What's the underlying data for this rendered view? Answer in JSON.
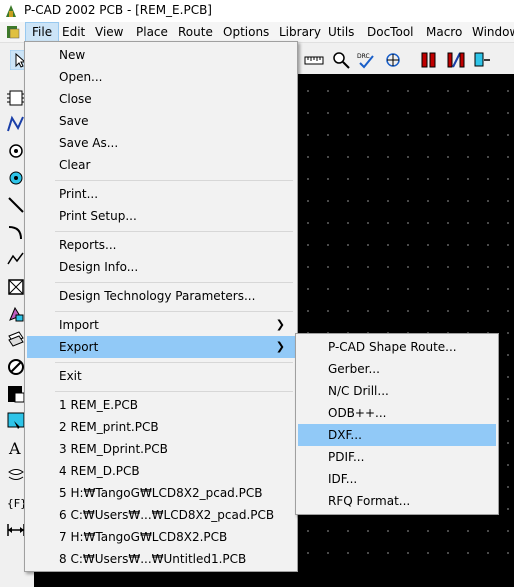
{
  "window": {
    "title": "P-CAD 2002 PCB - [REM_E.PCB]"
  },
  "menubar": {
    "items": [
      "File",
      "Edit",
      "View",
      "Place",
      "Route",
      "Options",
      "Library",
      "Utils",
      "DocTool",
      "Macro",
      "Window"
    ],
    "active": "File"
  },
  "toolbar": {
    "icons": [
      "select-icon",
      "ruler-icon",
      "zoom-icon",
      "drc-icon",
      "reroute-icon",
      "pads-icon",
      "traces-icon",
      "copper-icon"
    ]
  },
  "left_tools": [
    "component-icon",
    "route-icon",
    "pad-icon",
    "via-icon",
    "line-icon",
    "arc-icon",
    "polyline-icon",
    "polygon-icon",
    "cutout-icon",
    "plane-icon",
    "keepout-icon",
    "copper-pour-icon",
    "field-icon",
    "text-icon",
    "attribute-icon",
    "ref-point-icon",
    "dimension-icon"
  ],
  "file_menu": {
    "items": [
      {
        "label": "New"
      },
      {
        "label": "Open..."
      },
      {
        "label": "Close"
      },
      {
        "label": "Save"
      },
      {
        "label": "Save As..."
      },
      {
        "label": "Clear"
      },
      {
        "label": "Print..."
      },
      {
        "label": "Print Setup..."
      },
      {
        "label": "Reports..."
      },
      {
        "label": "Design Info..."
      },
      {
        "label": "Design Technology Parameters..."
      },
      {
        "label": "Import"
      },
      {
        "label": "Export"
      },
      {
        "label": "Exit"
      },
      {
        "label": "1 REM_E.PCB"
      },
      {
        "label": "2 REM_print.PCB"
      },
      {
        "label": "3 REM_Dprint.PCB"
      },
      {
        "label": "4 REM_D.PCB"
      },
      {
        "label": "5 H:₩TangoG₩LCD8X2_pcad.PCB"
      },
      {
        "label": "6 C:₩Users₩...₩LCD8X2_pcad.PCB"
      },
      {
        "label": "7 H:₩TangoG₩LCD8X2.PCB"
      },
      {
        "label": "8 C:₩Users₩...₩Untitled1.PCB"
      }
    ],
    "highlighted": "Export"
  },
  "export_submenu": {
    "items": [
      {
        "label": "P-CAD Shape Route..."
      },
      {
        "label": "Gerber..."
      },
      {
        "label": "N/C Drill..."
      },
      {
        "label": "ODB++..."
      },
      {
        "label": "DXF..."
      },
      {
        "label": "PDIF..."
      },
      {
        "label": "IDF..."
      },
      {
        "label": "RFQ Format..."
      }
    ],
    "highlighted": "DXF..."
  },
  "colors": {
    "highlight": "#91c9f7",
    "menubar_active": "#cce4f7",
    "canvas": "#000000",
    "grid": "#7a7a7a"
  }
}
